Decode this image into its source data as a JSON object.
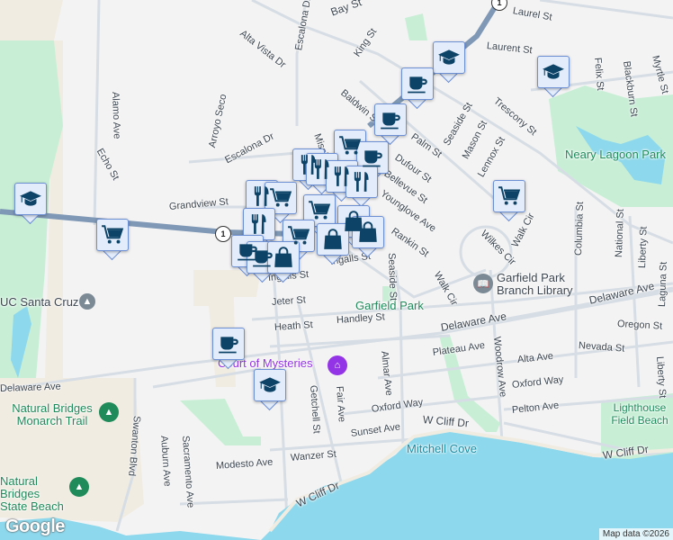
{
  "map": {
    "colors": {
      "land": "#f4f3f4",
      "water": "#8dd8ec",
      "park": "#c8efd6",
      "campus": "#f1ece2",
      "road": "#d6dde4",
      "highway": "#7f98b5",
      "marker_fill": "#e3ecfb",
      "marker_icon": "#0d4366"
    },
    "highway_shield": "1",
    "streets": [
      "Bay St",
      "Laurel St",
      "Laurent St",
      "Alta Vista Dr",
      "Escalona Dr",
      "King St",
      "Baldwin St",
      "Palm St",
      "Seaside St",
      "Mason St",
      "Trescony St",
      "Dufour St",
      "Lennox St",
      "Bellevue St",
      "Younglove Ave",
      "Rankin St",
      "Wilkes Cir",
      "Walk Cir",
      "Walk Cir",
      "Felix St",
      "Blackburn St",
      "Myrtle St",
      "Columbia St",
      "National St",
      "Liberty St",
      "Alamo Ave",
      "Echo St",
      "Arroyo Seco",
      "Escalona Dr",
      "Grandview St",
      "Mission St",
      "Ingalls St",
      "Ingalls St",
      "Jeter St",
      "Heath St",
      "Handley St",
      "Delaware Ave",
      "Delaware Ave",
      "Oregon St",
      "Laguna St",
      "Nevada St",
      "Plateau Ave",
      "Alta Ave",
      "Oxford Way",
      "Oxford Way",
      "Woodrow Ave",
      "Almar Ave",
      "Seaside St",
      "Fair Ave",
      "Getchell St",
      "Pelton Ave",
      "Sunset Ave",
      "W Cliff Dr",
      "W Cliff Dr",
      "W Cliff Dr",
      "Wanzer St",
      "Modesto Ave",
      "Swanton Blvd",
      "Auburn Ave",
      "Sacramento Ave",
      "Delaware Ave",
      "Liberty St"
    ],
    "places": {
      "neary_lagoon": "Neary Lagoon Park",
      "garfield_park": "Garfield Park",
      "library": "Garfield Park Branch Library",
      "court": "Court of Mysteries",
      "ucsc": "UC Santa Cruz",
      "nb_trail": "Natural Bridges Monarch Trail",
      "nb_beach": "Natural Bridges State Beach",
      "mitchell_cove": "Mitchell Cove",
      "lighthouse": "Lighthouse Field Beach"
    },
    "markers": [
      "school",
      "shopping-cart",
      "school",
      "coffee",
      "coffee",
      "school",
      "shopping-cart",
      "shopping-cart",
      "coffee",
      "restaurant",
      "restaurant",
      "restaurant",
      "restaurant",
      "restaurant",
      "shopping-cart",
      "shopping-cart",
      "shopping-cart",
      "restaurant",
      "shopping-bag",
      "shopping-bag",
      "shopping-bag",
      "coffee",
      "coffee",
      "shopping-bag",
      "coffee",
      "school"
    ],
    "google_logo": "Google",
    "attribution": "Map data ©2026"
  }
}
